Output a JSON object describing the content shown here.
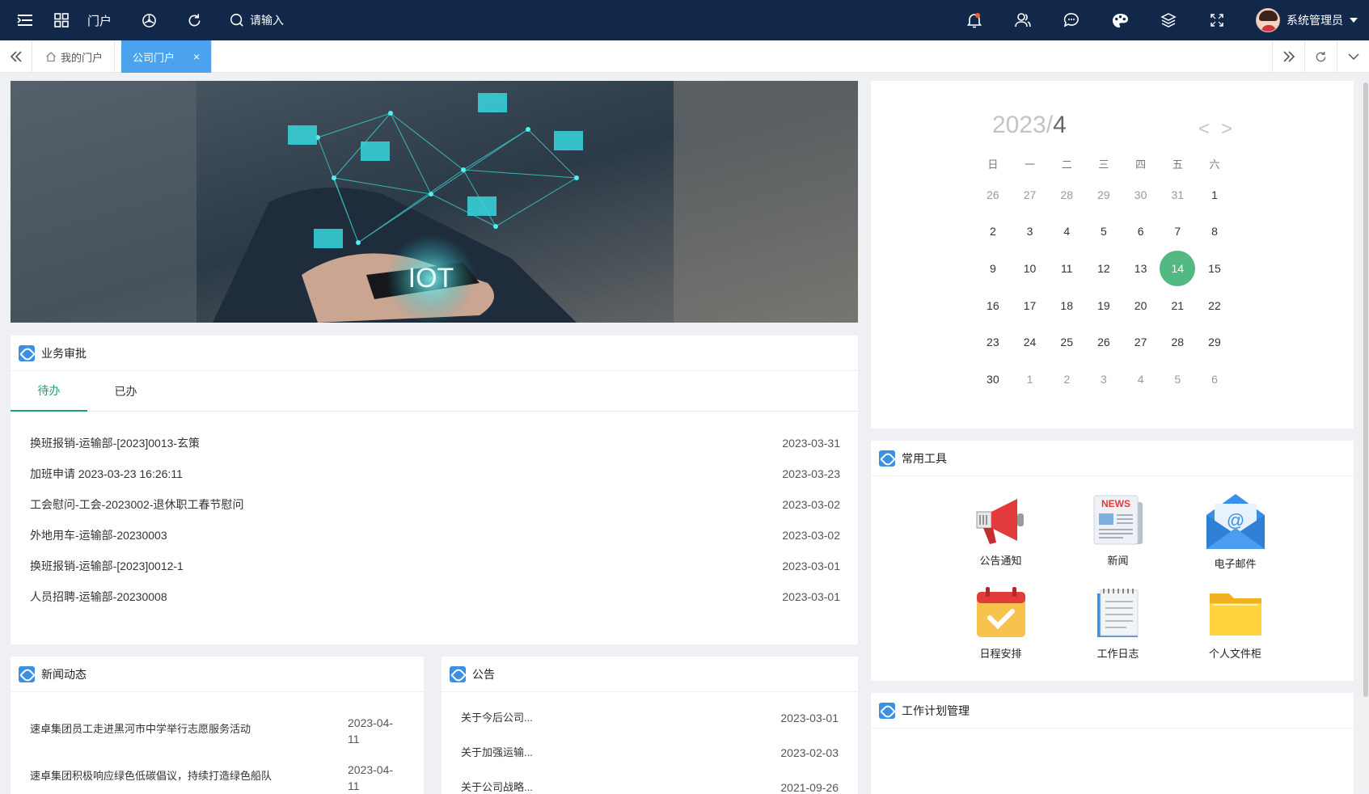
{
  "header": {
    "portal_label": "门户",
    "search_placeholder": "请输入",
    "user_name": "系统管理员"
  },
  "tabs": {
    "items": [
      {
        "label": "我的门户",
        "active": false
      },
      {
        "label": "公司门户",
        "active": true
      }
    ],
    "close_glyph": "×"
  },
  "banner": {
    "text": "IOT"
  },
  "approval": {
    "title": "业务审批",
    "subtabs": [
      "待办",
      "已办"
    ],
    "rows": [
      {
        "title": "换班报销-运输部-[2023]0013-玄策",
        "date": "2023-03-31"
      },
      {
        "title": "加班申请 2023-03-23 16:26:11",
        "date": "2023-03-23"
      },
      {
        "title": "工会慰问-工会-2023002-退休职工春节慰问",
        "date": "2023-03-02"
      },
      {
        "title": "外地用车-运输部-20230003",
        "date": "2023-03-02"
      },
      {
        "title": "换班报销-运输部-[2023]0012-1",
        "date": "2023-03-01"
      },
      {
        "title": "人员招聘-运输部-20230008",
        "date": "2023-03-01"
      }
    ]
  },
  "calendar": {
    "year": "2023/",
    "month": "4",
    "prev": "<",
    "next": ">",
    "weekdays": [
      "日",
      "一",
      "二",
      "三",
      "四",
      "五",
      "六"
    ],
    "weeks": [
      [
        "26",
        "27",
        "28",
        "29",
        "30",
        "31",
        "1"
      ],
      [
        "2",
        "3",
        "4",
        "5",
        "6",
        "7",
        "8"
      ],
      [
        "9",
        "10",
        "11",
        "12",
        "13",
        "14",
        "15"
      ],
      [
        "16",
        "17",
        "18",
        "19",
        "20",
        "21",
        "22"
      ],
      [
        "23",
        "24",
        "25",
        "26",
        "27",
        "28",
        "29"
      ],
      [
        "30",
        "1",
        "2",
        "3",
        "4",
        "5",
        "6"
      ]
    ],
    "today": "14"
  },
  "tools": {
    "title": "常用工具",
    "items": [
      {
        "label": "公告通知",
        "icon": "megaphone-icon"
      },
      {
        "label": "新闻",
        "icon": "newspaper-icon",
        "badge": "NEWS"
      },
      {
        "label": "电子邮件",
        "icon": "email-icon"
      },
      {
        "label": "日程安排",
        "icon": "calendar-check-icon"
      },
      {
        "label": "工作日志",
        "icon": "notepad-icon"
      },
      {
        "label": "个人文件柜",
        "icon": "folder-icon"
      }
    ]
  },
  "news": {
    "title": "新闻动态",
    "rows": [
      {
        "title": "速卓集团员工走进黑河市中学举行志愿服务活动",
        "date": "2023-04-11"
      },
      {
        "title": "速卓集团积极响应绿色低碳倡议，持续打造绿色船队",
        "date": "2023-04-11"
      }
    ]
  },
  "notices": {
    "title": "公告",
    "rows": [
      {
        "title": "关于今后公司...",
        "date": "2023-03-01"
      },
      {
        "title": "关于加强运输...",
        "date": "2023-02-03"
      },
      {
        "title": "关于公司战略...",
        "date": "2021-09-26"
      }
    ]
  },
  "workplan": {
    "title": "工作计划管理"
  },
  "colors": {
    "topbar": "#12284b",
    "active_tab": "#4aa3ec",
    "accent_green": "#1aa17a",
    "today": "#52b983"
  }
}
